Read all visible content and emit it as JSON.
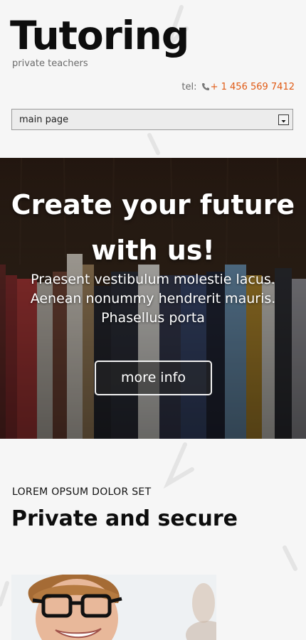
{
  "header": {
    "logo": "Tutoring",
    "tagline": "private teachers",
    "phone_label": "tel:",
    "phone_number": "+ 1 456 569 7412"
  },
  "nav": {
    "selected": "main page"
  },
  "hero": {
    "title_line1": "Create your future",
    "title_line2": "with us!",
    "text_line1": "Praesent vestibulum molestie lacus.",
    "text_line2": "Aenean nonummy hendrerit mauris.",
    "text_line3": "Phasellus porta",
    "button_label": "more info"
  },
  "section": {
    "label": "LOREM OPSUM DOLOR SET",
    "title": "Private and secure"
  },
  "colors": {
    "accent": "#e05a14",
    "background": "#f6f6f6",
    "text": "#0d0d0d"
  },
  "icons": {
    "phone": "phone-icon",
    "dropdown": "chevron-down-icon"
  }
}
